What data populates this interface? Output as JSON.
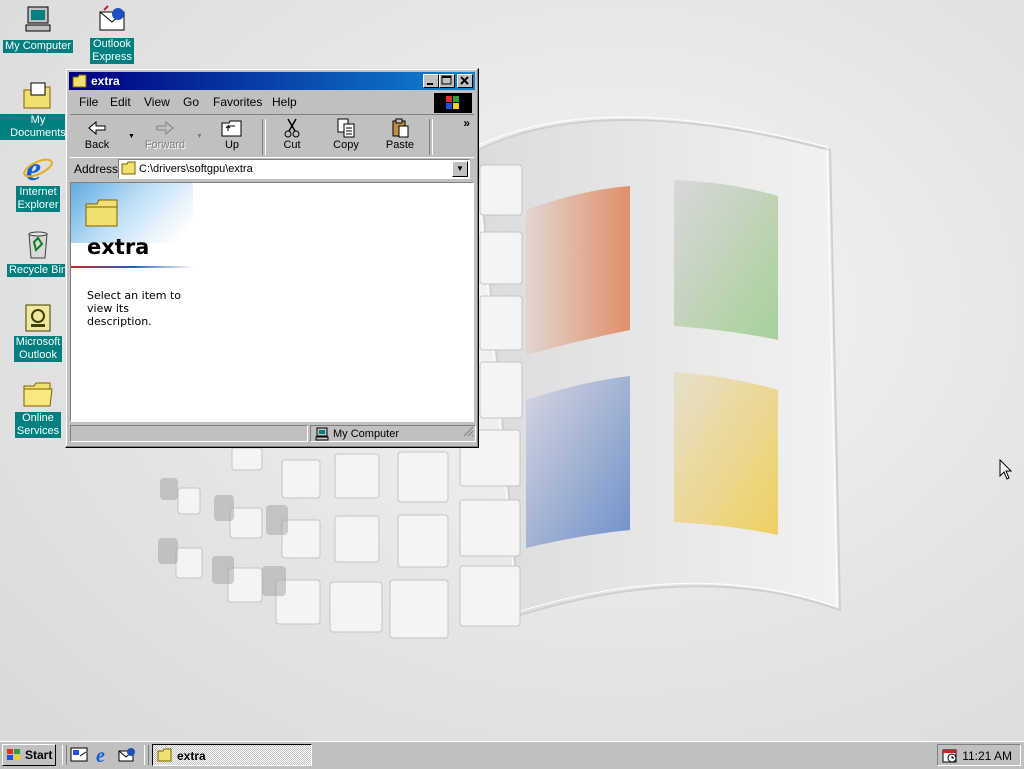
{
  "desktop": {
    "icons": [
      {
        "label": "My Computer",
        "icon": "my-computer-icon"
      },
      {
        "label": "Outlook\nExpress",
        "icon": "outlook-express-icon"
      },
      {
        "label": "My Documents",
        "icon": "my-documents-icon"
      },
      {
        "label": "Internet\nExplorer",
        "icon": "internet-explorer-icon"
      },
      {
        "label": "Recycle Bin",
        "icon": "recycle-bin-icon"
      },
      {
        "label": "Microsoft\nOutlook",
        "icon": "microsoft-outlook-icon"
      },
      {
        "label": "Online\nServices",
        "icon": "online-services-folder-icon"
      }
    ]
  },
  "window": {
    "title": "extra",
    "menu": [
      "File",
      "Edit",
      "View",
      "Go",
      "Favorites",
      "Help"
    ],
    "toolbar": {
      "back": "Back",
      "forward": "Forward",
      "up": "Up",
      "cut": "Cut",
      "copy": "Copy",
      "paste": "Paste",
      "more": "»"
    },
    "address_label": "Address",
    "address_value": "C:\\drivers\\softgpu\\extra",
    "content": {
      "folder_name": "extra",
      "description": "Select an item to view its description."
    },
    "status": {
      "location": "My Computer"
    }
  },
  "taskbar": {
    "start_label": "Start",
    "tasks": [
      {
        "label": "extra"
      }
    ],
    "clock": "11:21 AM"
  },
  "colors": {
    "desktop_label_bg": "#008080",
    "titlebar_start": "#000080",
    "titlebar_end": "#1084d0",
    "face": "#c0c0c0"
  }
}
